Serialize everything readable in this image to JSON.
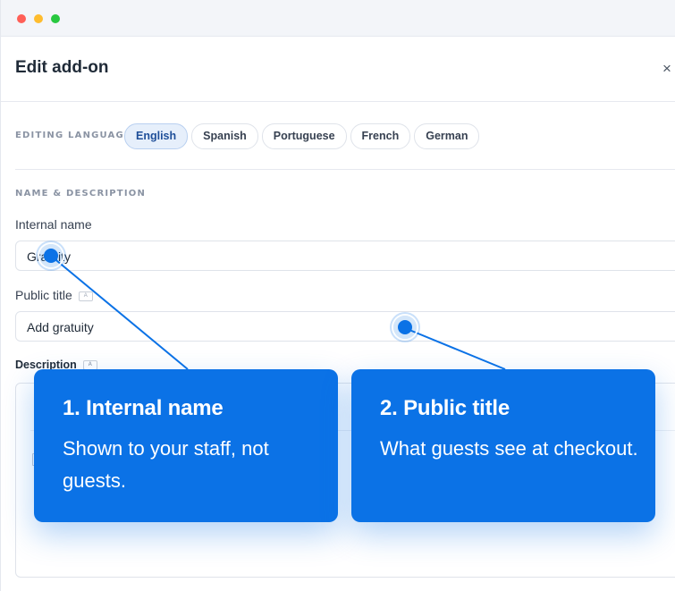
{
  "header": {
    "title": "Edit add-on",
    "close_glyph": "×"
  },
  "language": {
    "label": "EDITING LANGUAGE",
    "options": [
      "English",
      "Spanish",
      "Portuguese",
      "French",
      "German"
    ],
    "selected": "English"
  },
  "section": {
    "label": "NAME & DESCRIPTION"
  },
  "fields": {
    "internal_name": {
      "label": "Internal name",
      "value": "Gratuity"
    },
    "public_title": {
      "label": "Public title",
      "value": "Add gratuity"
    },
    "description": {
      "label": "Description"
    }
  },
  "callouts": [
    {
      "title": "1. Internal name",
      "body": "Shown to your staff, not guests."
    },
    {
      "title": "2. Public title",
      "body": "What guests see at checkout."
    }
  ],
  "colors": {
    "accent": "#0b72e6",
    "chip_active_bg": "#e6effb"
  }
}
